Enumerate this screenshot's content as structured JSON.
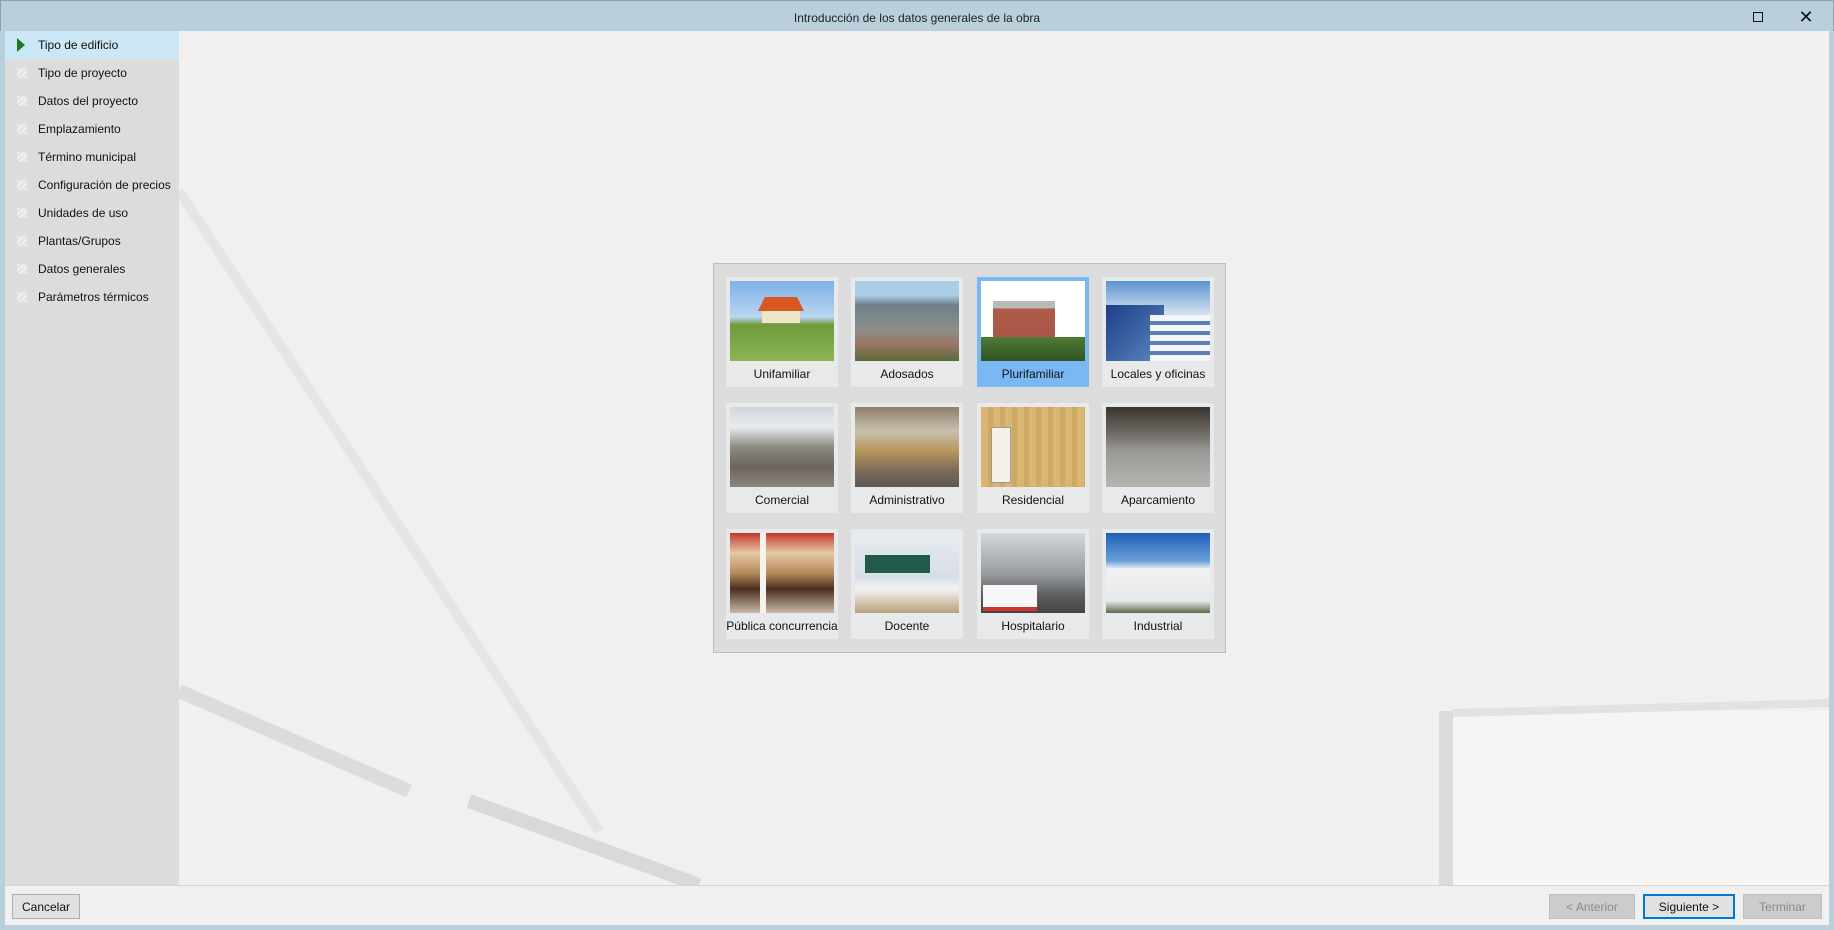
{
  "window": {
    "title": "Introducción de los datos generales de la obra"
  },
  "sidebar": {
    "items": [
      {
        "label": "Tipo de edificio",
        "active": true
      },
      {
        "label": "Tipo de proyecto"
      },
      {
        "label": "Datos del proyecto"
      },
      {
        "label": "Emplazamiento"
      },
      {
        "label": "Término municipal"
      },
      {
        "label": "Configuración de precios"
      },
      {
        "label": "Unidades de uso"
      },
      {
        "label": "Plantas/Grupos"
      },
      {
        "label": "Datos generales"
      },
      {
        "label": "Parámetros térmicos"
      }
    ]
  },
  "building_types": [
    {
      "label": "Unifamiliar"
    },
    {
      "label": "Adosados"
    },
    {
      "label": "Plurifamiliar",
      "selected": true
    },
    {
      "label": "Locales y oficinas"
    },
    {
      "label": "Comercial"
    },
    {
      "label": "Administrativo"
    },
    {
      "label": "Residencial"
    },
    {
      "label": "Aparcamiento"
    },
    {
      "label": "Pública concurrencia"
    },
    {
      "label": "Docente"
    },
    {
      "label": "Hospitalario"
    },
    {
      "label": "Industrial"
    }
  ],
  "footer": {
    "cancel": "Cancelar",
    "previous": "< Anterior",
    "next": "Siguiente >",
    "finish": "Terminar"
  },
  "colors": {
    "accent": "#0078d7",
    "selected_tile": "#7ab7f5",
    "active_step": "#cce8f6"
  }
}
